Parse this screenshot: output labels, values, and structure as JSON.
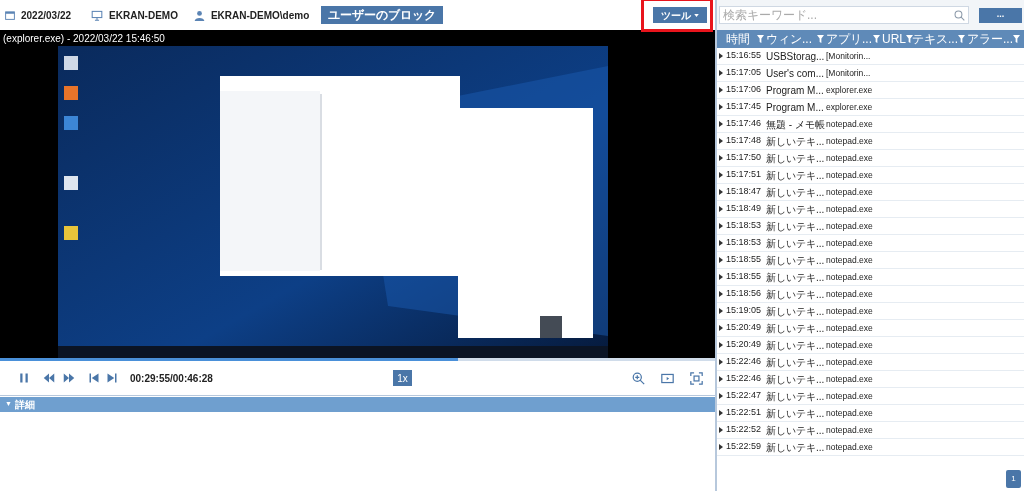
{
  "header": {
    "date": "2022/03/22",
    "computer": "EKRAN-DEMO",
    "user": "EKRAN-DEMO\\demo",
    "block_button": "ユーザーのブロック",
    "tools_button": "ツール",
    "tools_highlighted": true
  },
  "player": {
    "title": "(explorer.exe) - 2022/03/22 15:46:50",
    "progress": {
      "level": 0.64
    },
    "time": "00:29:55/00:46:28",
    "speed": "1x"
  },
  "details": {
    "toggle": "▼",
    "label": "詳細"
  },
  "search": {
    "placeholder": "検索キーワード...",
    "button": "..."
  },
  "table": {
    "columns": [
      "時間",
      "ウィン...",
      "アプリ...",
      "URL",
      "テキス...",
      "アラー..."
    ],
    "rows": [
      {
        "time": "15:16:55",
        "window": "USBStorag...",
        "application": "[Monitorin..."
      },
      {
        "time": "15:17:05",
        "window": "User's com...",
        "application": "[Monitorin..."
      },
      {
        "time": "15:17:06",
        "window": "Program M...",
        "application": "explorer.exe"
      },
      {
        "time": "15:17:45",
        "window": "Program M...",
        "application": "explorer.exe"
      },
      {
        "time": "15:17:46",
        "window": "無題 - メモ帳",
        "application": "notepad.exe"
      },
      {
        "time": "15:17:48",
        "window": "新しいテキ...",
        "application": "notepad.exe"
      },
      {
        "time": "15:17:50",
        "window": "新しいテキ...",
        "application": "notepad.exe"
      },
      {
        "time": "15:17:51",
        "window": "新しいテキ...",
        "application": "notepad.exe"
      },
      {
        "time": "15:18:47",
        "window": "新しいテキ...",
        "application": "notepad.exe"
      },
      {
        "time": "15:18:49",
        "window": "新しいテキ...",
        "application": "notepad.exe"
      },
      {
        "time": "15:18:53",
        "window": "新しいテキ...",
        "application": "notepad.exe"
      },
      {
        "time": "15:18:53",
        "window": "新しいテキ...",
        "application": "notepad.exe"
      },
      {
        "time": "15:18:55",
        "window": "新しいテキ...",
        "application": "notepad.exe"
      },
      {
        "time": "15:18:55",
        "window": "新しいテキ...",
        "application": "notepad.exe"
      },
      {
        "time": "15:18:56",
        "window": "新しいテキ...",
        "application": "notepad.exe"
      },
      {
        "time": "15:19:05",
        "window": "新しいテキ...",
        "application": "notepad.exe"
      },
      {
        "time": "15:20:49",
        "window": "新しいテキ...",
        "application": "notepad.exe"
      },
      {
        "time": "15:20:49",
        "window": "新しいテキ...",
        "application": "notepad.exe"
      },
      {
        "time": "15:22:46",
        "window": "新しいテキ...",
        "application": "notepad.exe"
      },
      {
        "time": "15:22:46",
        "window": "新しいテキ...",
        "application": "notepad.exe"
      },
      {
        "time": "15:22:47",
        "window": "新しいテキ...",
        "application": "notepad.exe"
      },
      {
        "time": "15:22:51",
        "window": "新しいテキ...",
        "application": "notepad.exe"
      },
      {
        "time": "15:22:52",
        "window": "新しいテキ...",
        "application": "notepad.exe"
      },
      {
        "time": "15:22:59",
        "window": "新しいテキ...",
        "application": "notepad.exe"
      }
    ]
  },
  "pagination": [
    {
      "label": "1",
      "selected": true
    }
  ]
}
